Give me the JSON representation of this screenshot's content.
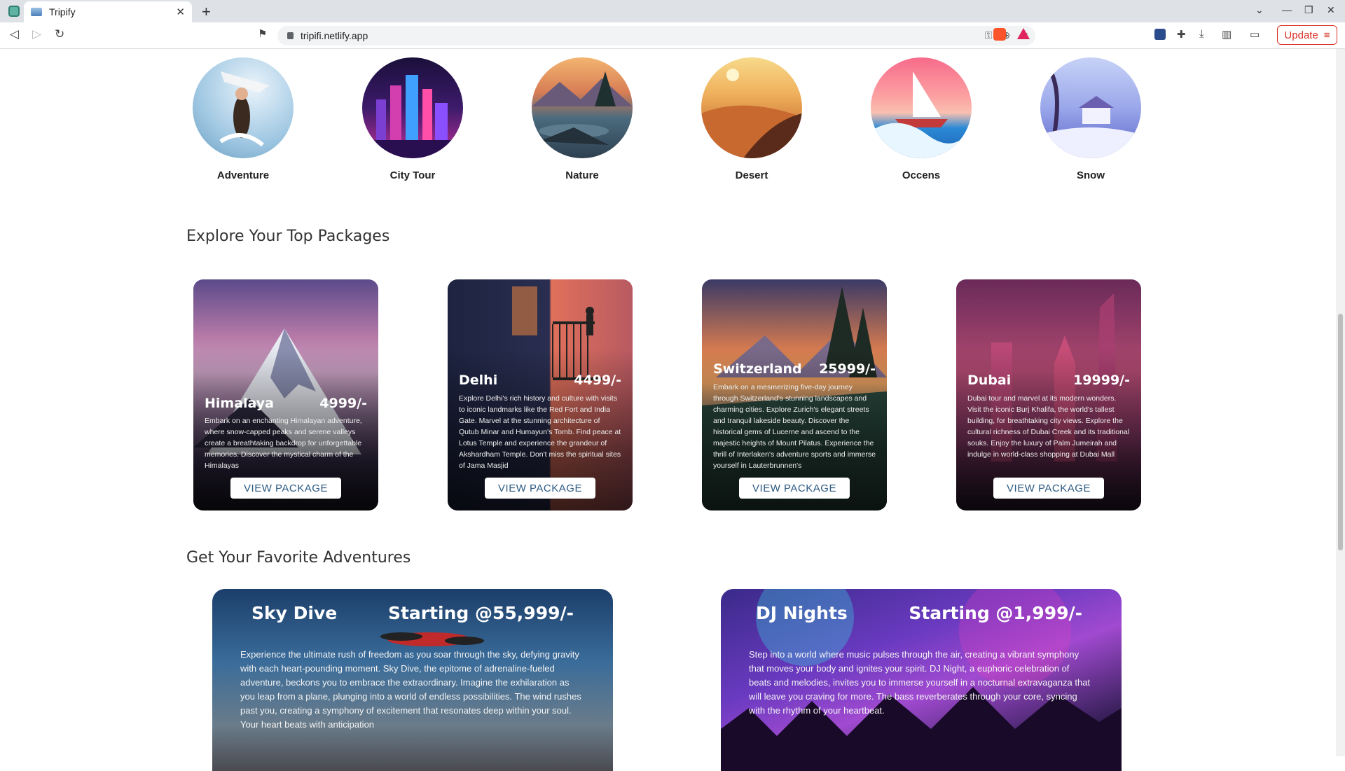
{
  "browser": {
    "tab_title": "Tripify",
    "url": "tripifi.netlify.app",
    "update_label": "Update"
  },
  "categories": [
    {
      "label": "Adventure"
    },
    {
      "label": "City Tour"
    },
    {
      "label": "Nature"
    },
    {
      "label": "Desert"
    },
    {
      "label": "Occens"
    },
    {
      "label": "Snow"
    }
  ],
  "packages_section": {
    "title": "Explore Your Top Packages",
    "button_label": "VIEW PACKAGE",
    "items": [
      {
        "name": "Himalaya",
        "price": "4999/-",
        "description": "Embark on an enchanting Himalayan adventure, where snow-capped peaks and serene valleys create a breathtaking backdrop for unforgettable memories. Discover the mystical charm of the Himalayas"
      },
      {
        "name": "Delhi",
        "price": "4499/-",
        "description": "Explore Delhi's rich history and culture with visits to iconic landmarks like the Red Fort and India Gate. Marvel at the stunning architecture of Qutub Minar and Humayun's Tomb. Find peace at Lotus Temple and experience the grandeur of Akshardham Temple. Don't miss the spiritual sites of Jama Masjid"
      },
      {
        "name": "Switzerland",
        "price": "25999/-",
        "description": "Embark on a mesmerizing five-day journey through Switzerland's stunning landscapes and charming cities. Explore Zurich's elegant streets and tranquil lakeside beauty. Discover the historical gems of Lucerne and ascend to the majestic heights of Mount Pilatus. Experience the thrill of Interlaken's adventure sports and immerse yourself in Lauterbrunnen's"
      },
      {
        "name": "Dubai",
        "price": "19999/-",
        "description": "Dubai tour and marvel at its modern wonders. Visit the iconic Burj Khalifa, the world's tallest building, for breathtaking city views. Explore the cultural richness of Dubai Creek and its traditional souks. Enjoy the luxury of Palm Jumeirah and indulge in world-class shopping at Dubai Mall"
      }
    ]
  },
  "adventures_section": {
    "title": "Get Your Favorite Adventures",
    "items": [
      {
        "name": "Sky Dive",
        "price": "Starting @55,999/-",
        "description": "Experience the ultimate rush of freedom as you soar through the sky, defying gravity with each heart-pounding moment. Sky Dive, the epitome of adrenaline-fueled adventure, beckons you to embrace the extraordinary. Imagine the exhilaration as you leap from a plane, plunging into a world of endless possibilities. The wind rushes past you, creating a symphony of excitement that resonates deep within your soul. Your heart beats with anticipation"
      },
      {
        "name": "DJ Nights",
        "price": "Starting @1,999/-",
        "description": "Step into a world where music pulses through the air, creating a vibrant symphony that moves your body and ignites your spirit. DJ Night, a euphoric celebration of beats and melodies, invites you to immerse yourself in a nocturnal extravaganza that will leave you craving for more. The bass reverberates through your core, syncing with the rhythm of your heartbeat."
      }
    ]
  }
}
